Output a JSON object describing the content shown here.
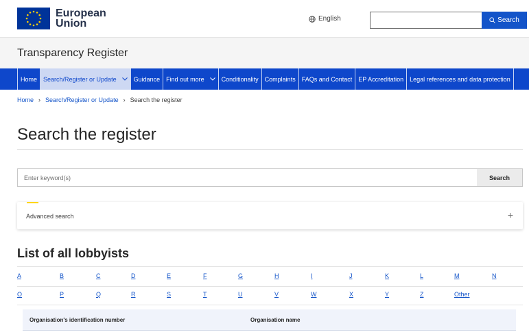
{
  "header": {
    "logo_line1": "European",
    "logo_line2": "Union",
    "language": "English",
    "search_button": "Search",
    "search_value": ""
  },
  "site": {
    "title": "Transparency Register"
  },
  "nav": {
    "items": [
      {
        "label": "Home",
        "active": false,
        "dropdown": false
      },
      {
        "label": "Search/Register or Update",
        "active": true,
        "dropdown": true
      },
      {
        "label": "Guidance",
        "active": false,
        "dropdown": false
      },
      {
        "label": "Find out more",
        "active": false,
        "dropdown": true
      },
      {
        "label": "Conditionality",
        "active": false,
        "dropdown": false
      },
      {
        "label": "Complaints",
        "active": false,
        "dropdown": false
      },
      {
        "label": "FAQs and Contact",
        "active": false,
        "dropdown": false
      },
      {
        "label": "EP Accreditation",
        "active": false,
        "dropdown": false
      },
      {
        "label": "Legal references and data protection",
        "active": false,
        "dropdown": false
      }
    ]
  },
  "breadcrumb": {
    "items": [
      "Home",
      "Search/Register or Update",
      "Search the register"
    ]
  },
  "main": {
    "title": "Search the register",
    "keyword_placeholder": "Enter keyword(s)",
    "keyword_value": "",
    "search_button": "Search",
    "advanced_search": "Advanced search",
    "advanced_toggle": "+"
  },
  "lobbyists": {
    "title": "List of all lobbyists",
    "row1": [
      "A",
      "B",
      "C",
      "D",
      "E",
      "F",
      "G",
      "H",
      "I",
      "J",
      "K",
      "L",
      "M",
      "N"
    ],
    "row2": [
      "O",
      "P",
      "Q",
      "R",
      "S",
      "T",
      "U",
      "V",
      "W",
      "X",
      "Y",
      "Z",
      "Other"
    ],
    "table_headers": [
      "Organisation's identification number",
      "Organisation name"
    ]
  },
  "colors": {
    "eu_blue": "#003399",
    "eu_yellow": "#ffcc00",
    "nav_blue": "#0e47cb",
    "link_blue": "#1354c9",
    "accent_yellow": "#ffd617"
  }
}
